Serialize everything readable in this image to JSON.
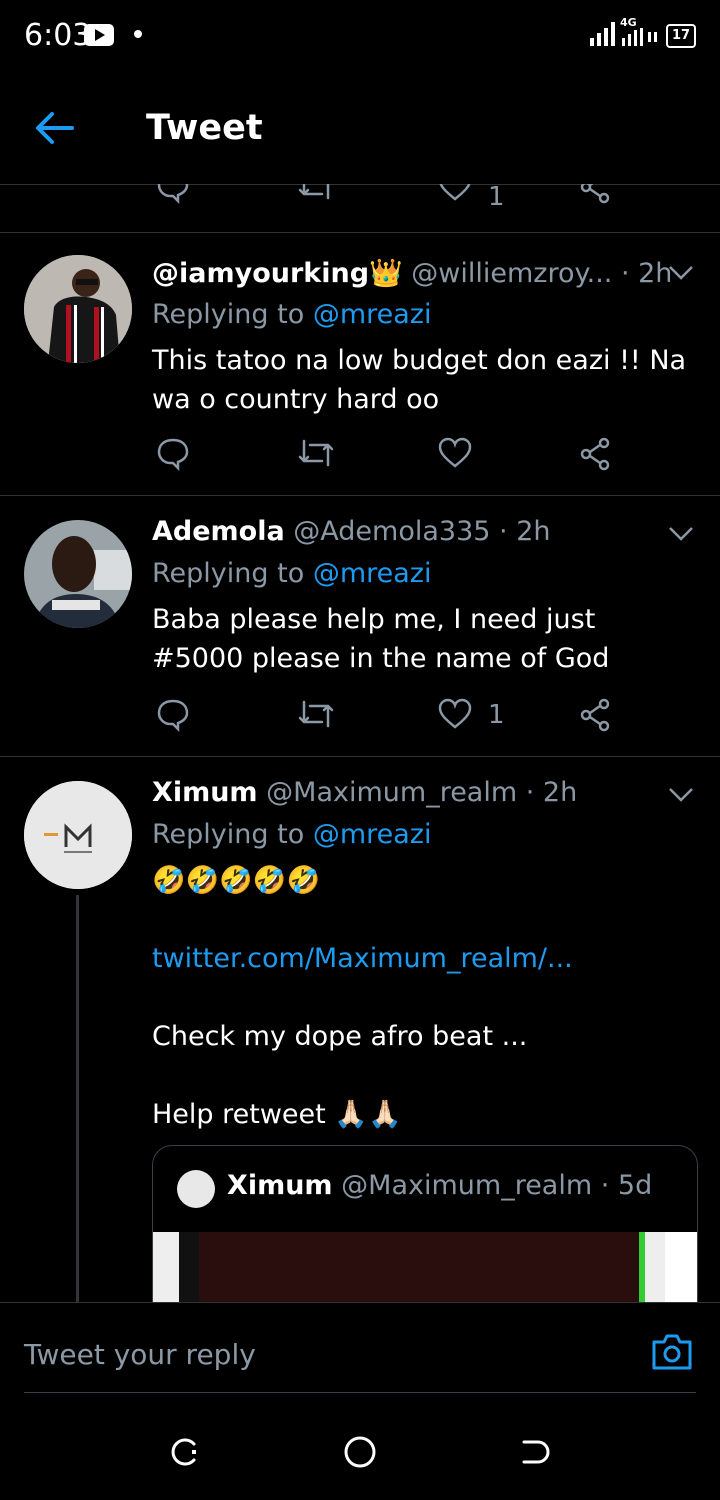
{
  "status": {
    "time": "6:03",
    "network": "4G",
    "battery": "17"
  },
  "header": {
    "title": "Tweet"
  },
  "partial_row": {
    "like_count": "1"
  },
  "tweets": [
    {
      "name": "@iamyourking",
      "name_emoji": "👑",
      "handle": "@williemzroy...",
      "time": "· 2h",
      "replying_prefix": "Replying to",
      "replying_to": "@mreazi",
      "text": "This tatoo na low budget don eazi !! Na wa o country hard oo",
      "like_count": ""
    },
    {
      "name": "Ademola",
      "handle": "@Ademola335",
      "time": "· 2h",
      "replying_prefix": "Replying to",
      "replying_to": "@mreazi",
      "text": "Baba please help me, I need just #5000 please in the name of God",
      "like_count": "1"
    },
    {
      "name": "Ximum",
      "handle": "@Maximum_realm",
      "time": "· 2h",
      "replying_prefix": "Replying to",
      "replying_to": "@mreazi",
      "emoji_line": "🤣🤣🤣🤣🤣",
      "link": "twitter.com/Maximum_realm/...",
      "line2": "Check my dope afro beat ...",
      "line3": "Help retweet",
      "line3_emoji": "🙏🏻🙏🏻",
      "avatar_brand": "maximum",
      "quote": {
        "name": "Ximum",
        "handle": "@Maximum_realm",
        "time": "· 5d"
      }
    }
  ],
  "reply_bar": {
    "placeholder": "Tweet your reply"
  },
  "colors": {
    "accent": "#1d9bf0",
    "muted": "#8b98a5",
    "divider": "#2f3336"
  }
}
